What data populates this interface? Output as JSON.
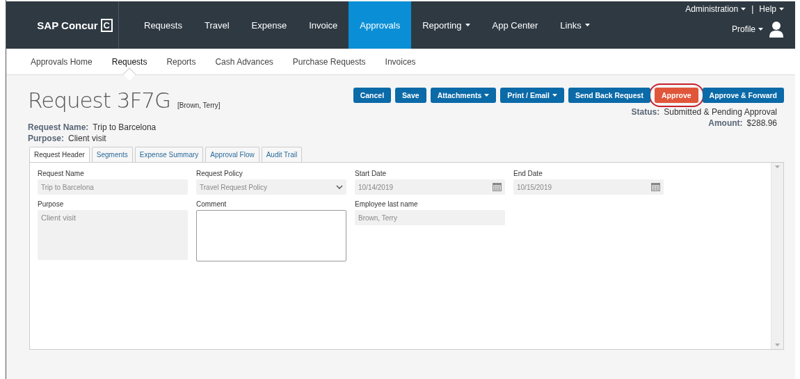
{
  "brand": {
    "name": "SAP Concur",
    "mark": "C"
  },
  "nav": [
    {
      "label": "Requests",
      "selected": false,
      "dropdown": false
    },
    {
      "label": "Travel",
      "selected": false,
      "dropdown": false
    },
    {
      "label": "Expense",
      "selected": false,
      "dropdown": false
    },
    {
      "label": "Invoice",
      "selected": false,
      "dropdown": false
    },
    {
      "label": "Approvals",
      "selected": true,
      "dropdown": false
    },
    {
      "label": "Reporting",
      "selected": false,
      "dropdown": true
    },
    {
      "label": "App Center",
      "selected": false,
      "dropdown": false
    },
    {
      "label": "Links",
      "selected": false,
      "dropdown": true
    }
  ],
  "utility": {
    "links": [
      {
        "label": "Administration"
      },
      {
        "label": "Help"
      }
    ],
    "separator": "|",
    "profile": "Profile"
  },
  "subnav": [
    {
      "label": "Approvals Home",
      "selected": false
    },
    {
      "label": "Requests",
      "selected": true
    },
    {
      "label": "Reports",
      "selected": false
    },
    {
      "label": "Cash Advances",
      "selected": false
    },
    {
      "label": "Purchase Requests",
      "selected": false
    },
    {
      "label": "Invoices",
      "selected": false
    }
  ],
  "request": {
    "title": "Request 3F7G",
    "owner": "[Brown, Terry]",
    "details": [
      {
        "label": "Request Name:",
        "value": "Trip to Barcelona"
      },
      {
        "label": "Purpose:",
        "value": "Client visit"
      }
    ],
    "summary": [
      {
        "label": "Status:",
        "value": "Submitted & Pending Approval"
      },
      {
        "label": "Amount:",
        "value": "$288.96"
      }
    ]
  },
  "actions": [
    {
      "label": "Cancel",
      "kind": "primary",
      "dropdown": false,
      "highlighted": false
    },
    {
      "label": "Save",
      "kind": "primary",
      "dropdown": false,
      "highlighted": false
    },
    {
      "label": "Attachments",
      "kind": "primary",
      "dropdown": true,
      "highlighted": false
    },
    {
      "label": "Print / Email",
      "kind": "primary",
      "dropdown": true,
      "highlighted": false
    },
    {
      "label": "Send Back Request",
      "kind": "primary",
      "dropdown": false,
      "highlighted": false
    },
    {
      "label": "Approve",
      "kind": "danger",
      "dropdown": false,
      "highlighted": true
    },
    {
      "label": "Approve & Forward",
      "kind": "primary",
      "dropdown": false,
      "highlighted": false
    }
  ],
  "tabs": [
    {
      "label": "Request Header",
      "selected": true
    },
    {
      "label": "Segments",
      "selected": false
    },
    {
      "label": "Expense Summary",
      "selected": false
    },
    {
      "label": "Approval Flow",
      "selected": false
    },
    {
      "label": "Audit Trail",
      "selected": false
    }
  ],
  "fields": [
    {
      "label": "Request Name",
      "kind": "text",
      "value": "Trip to Barcelona",
      "disabled": true
    },
    {
      "label": "Request Policy",
      "kind": "select",
      "value": "Travel Request Policy",
      "disabled": true
    },
    {
      "label": "Start Date",
      "kind": "date",
      "value": "10/14/2019",
      "disabled": true
    },
    {
      "label": "End Date",
      "kind": "date",
      "value": "10/15/2019",
      "disabled": true
    },
    {
      "label": "Purpose",
      "kind": "textarea",
      "value": "Client visit",
      "disabled": true
    },
    {
      "label": "Comment",
      "kind": "textarea",
      "disabled": false
    },
    {
      "label": "Employee last name",
      "kind": "text",
      "value": "Brown, Terry",
      "disabled": true
    }
  ]
}
